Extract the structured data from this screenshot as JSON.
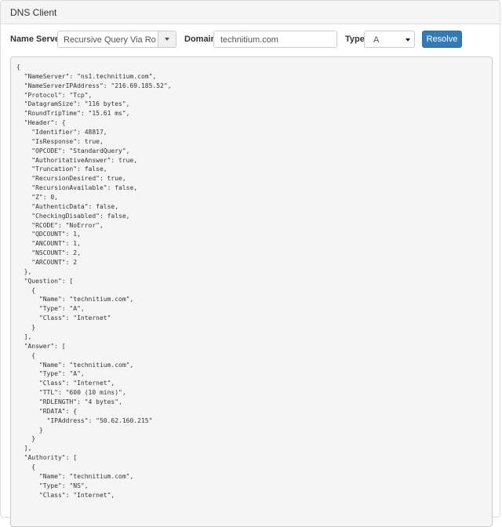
{
  "panel": {
    "title": "DNS Client"
  },
  "form": {
    "name_server_label": "Name Server",
    "name_server_value": "Recursive Query Via Root Servers",
    "domain_label": "Domain",
    "domain_value": "technitium.com",
    "type_label": "Type",
    "type_value": "A",
    "resolve_label": "Resolve"
  },
  "output": {
    "lines": [
      "{",
      "  \"NameServer\": \"ns1.technitium.com\",",
      "  \"NameServerIPAddress\": \"216.69.185.52\",",
      "  \"Protocol\": \"Tcp\",",
      "  \"DatagramSize\": \"116 bytes\",",
      "  \"RoundTripTime\": \"15.61 ms\",",
      "  \"Header\": {",
      "    \"Identifier\": 48817,",
      "    \"IsResponse\": true,",
      "    \"OPCODE\": \"StandardQuery\",",
      "    \"AuthoritativeAnswer\": true,",
      "    \"Truncation\": false,",
      "    \"RecursionDesired\": true,",
      "    \"RecursionAvailable\": false,",
      "    \"Z\": 0,",
      "    \"AuthenticData\": false,",
      "    \"CheckingDisabled\": false,",
      "    \"RCODE\": \"NoError\",",
      "    \"QDCOUNT\": 1,",
      "    \"ANCOUNT\": 1,",
      "    \"NSCOUNT\": 2,",
      "    \"ARCOUNT\": 2",
      "  },",
      "  \"Question\": [",
      "    {",
      "      \"Name\": \"technitium.com\",",
      "      \"Type\": \"A\",",
      "      \"Class\": \"Internet\"",
      "    }",
      "  ],",
      "  \"Answer\": [",
      "    {",
      "      \"Name\": \"technitium.com\",",
      "      \"Type\": \"A\",",
      "      \"Class\": \"Internet\",",
      "      \"TTL\": \"600 (10 mins)\",",
      "      \"RDLENGTH\": \"4 bytes\",",
      "      \"RDATA\": {",
      "        \"IPAddress\": \"50.62.160.215\"",
      "      }",
      "    }",
      "  ],",
      "  \"Authority\": [",
      "    {",
      "      \"Name\": \"technitium.com\",",
      "      \"Type\": \"NS\",",
      "      \"Class\": \"Internet\","
    ]
  }
}
